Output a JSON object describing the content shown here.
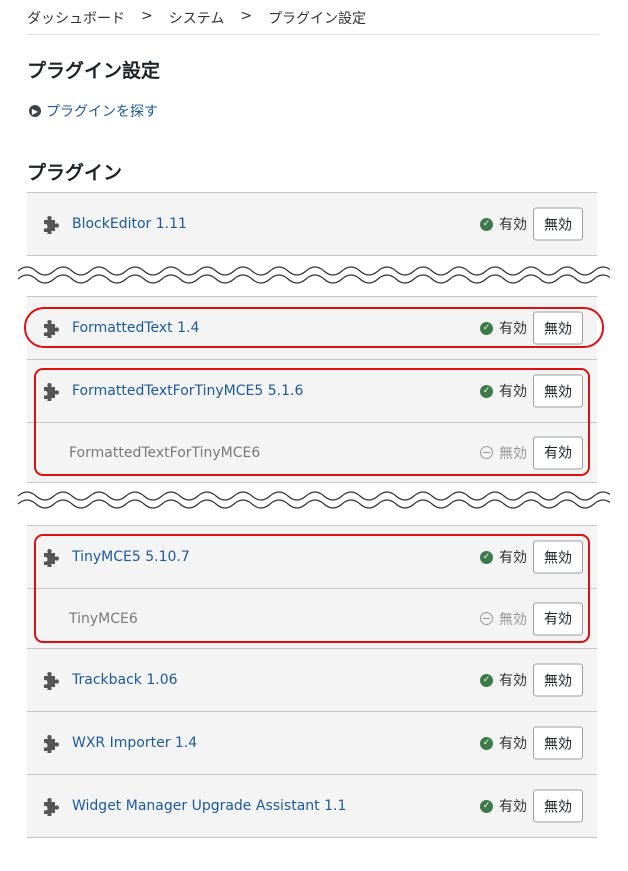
{
  "breadcrumb": {
    "items": [
      "ダッシュボード",
      "システム",
      "プラグイン設定"
    ],
    "separator": ">"
  },
  "page_title": "プラグイン設定",
  "find_link": {
    "label": "プラグインを探す",
    "icon": "chevron-right-circle-icon"
  },
  "section_title": "プラグイン",
  "status": {
    "enabled": "有効",
    "disabled": "無効"
  },
  "buttons": {
    "disable": "無効",
    "enable": "有効"
  },
  "plugins": [
    {
      "name": "BlockEditor 1.11",
      "state": "enabled",
      "button": "無効"
    },
    {
      "name": "FormattedText 1.4",
      "state": "enabled",
      "button": "無効"
    },
    {
      "name": "FormattedTextForTinyMCE5 5.1.6",
      "state": "enabled",
      "button": "無効"
    },
    {
      "name": "FormattedTextForTinyMCE6",
      "state": "disabled",
      "button": "有効"
    },
    {
      "name": "TinyMCE5 5.10.7",
      "state": "enabled",
      "button": "無効"
    },
    {
      "name": "TinyMCE6",
      "state": "disabled",
      "button": "有効"
    },
    {
      "name": "Trackback 1.06",
      "state": "enabled",
      "button": "無効"
    },
    {
      "name": "WXR Importer 1.4",
      "state": "enabled",
      "button": "無効"
    },
    {
      "name": "Widget Manager Upgrade Assistant 1.1",
      "state": "enabled",
      "button": "無効"
    }
  ],
  "colors": {
    "link": "#1c5a9c",
    "highlight": "#e01010",
    "enabled_icon": "#3c7a4c",
    "row_bg": "#f4f4f4"
  }
}
